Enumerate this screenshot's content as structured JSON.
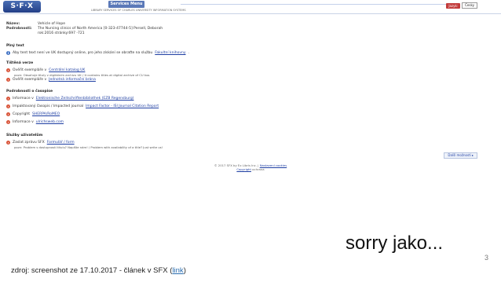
{
  "screenshot": {
    "banner": {
      "logo": "S·F·X",
      "title": "Services Menu",
      "subtitle": "LIBRARY SERVICES OF CHARLES UNIVERSITY INFORMATION SYSTEMS",
      "language_label": "Jazyk:",
      "language_value": "Česky"
    },
    "meta": {
      "name_label": "Název:",
      "name_value": "Vehicle of Hope",
      "details_label": "Podrobnosti:",
      "details_line1": "The Nursing clinics of North America [0-323-47744-5] Persell, Deborah",
      "details_line2": "rok:2016 stránky:697 -721"
    },
    "sections": {
      "fulltext": {
        "heading": "Plný text",
        "row_prefix": "Aby tent text není ve UK dostupný online, pro jeho získání se obraťte na službu",
        "row_link": "Fakultní knihovny",
        "row_suffix": "."
      },
      "print": {
        "heading": "Tištěná verze",
        "row1_prefix": "Ověřit exempláře v",
        "row1_link": "Centrální katalog UK",
        "row1_note": "pozn: Obsahuje tituly v digitálním archivu UK / It contains titles at digital archive of CU too.",
        "row2_prefix": "Ověřit exempláře v",
        "row2_link": "Jednotná informační brána"
      },
      "about": {
        "heading": "Podrobnosti o časopise",
        "row1_prefix": "Informace v",
        "row1_link": "Elektronische Zeitschriftenbibliothek (EZB Regensburg)",
        "row2_prefix": "Impaktovaný časopis / Impacted journal",
        "row2_link": "Impact Factor - ISI Journal Citation Report",
        "row3_prefix": "Copyright",
        "row3_link": "SHERPA/RoMEO",
        "row4_prefix": "Informace v",
        "row4_link": "ulrichsweb.com"
      },
      "services": {
        "heading": "Služby uživatelům",
        "row1_prefix": "Zaslat zprávu SFX",
        "row1_link": "Formulář / form",
        "row1_note": "pozn: Problem s dostupností titulu? Napište nám! / Problem with availability of a title? Just write us!"
      }
    },
    "more_button": "Další možnosti ▸",
    "footer": {
      "line1_prefix": "© 2017 SFX by Ex Libris Inc. |",
      "line1_link": "Nastavení cookies",
      "line2_link": "Copyright",
      "line2_suffix": "ochrana"
    }
  },
  "slide": {
    "caption": "sorry jako...",
    "source_prefix": "zdroj: screenshot ze 17.10.2017 - článek v SFX (",
    "source_link": "link",
    "source_suffix": ")",
    "page_number": "3"
  }
}
